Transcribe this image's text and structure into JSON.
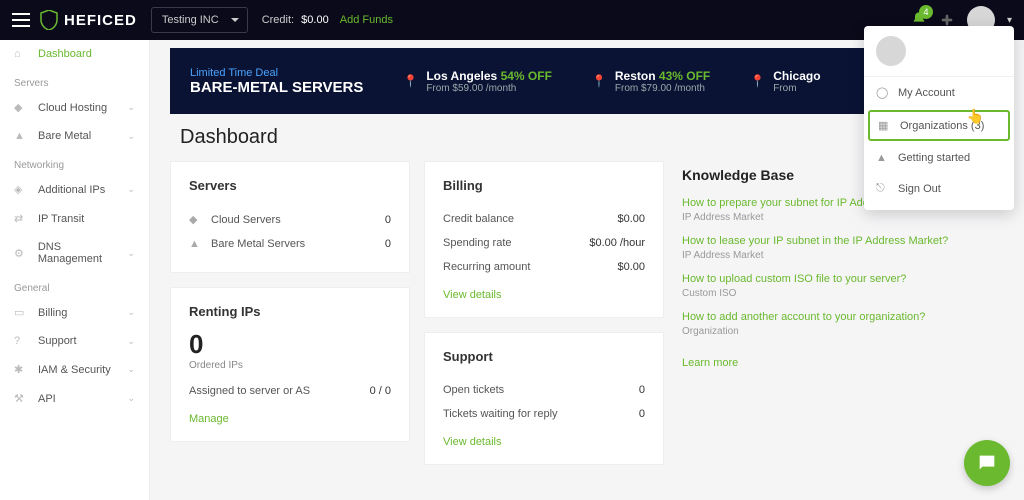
{
  "brand": "HEFICED",
  "org_selector": "Testing INC",
  "credit_label": "Credit:",
  "credit_value": "$0.00",
  "add_funds": "Add Funds",
  "notif_count": "4",
  "sidebar": {
    "dashboard": "Dashboard",
    "groups": {
      "servers": "Servers",
      "networking": "Networking",
      "general": "General"
    },
    "items": {
      "cloud_hosting": "Cloud Hosting",
      "bare_metal": "Bare Metal",
      "additional_ips": "Additional IPs",
      "ip_transit": "IP Transit",
      "dns": "DNS Management",
      "billing": "Billing",
      "support": "Support",
      "iam": "IAM & Security",
      "api": "API"
    }
  },
  "promo": {
    "tag": "Limited Time Deal",
    "title": "BARE-METAL SERVERS",
    "deals": [
      {
        "city": "Los Angeles",
        "pct": "54% OFF",
        "from": "From $59.00 /month"
      },
      {
        "city": "Reston",
        "pct": "43% OFF",
        "from": "From $79.00 /month"
      },
      {
        "city": "Chicago",
        "pct": "",
        "from": "From"
      }
    ]
  },
  "page_title": "Dashboard",
  "servers_card": {
    "title": "Servers",
    "cloud": {
      "label": "Cloud Servers",
      "count": "0"
    },
    "bare": {
      "label": "Bare Metal Servers",
      "count": "0"
    }
  },
  "renting_card": {
    "title": "Renting IPs",
    "count": "0",
    "ordered": "Ordered IPs",
    "assigned_label": "Assigned to server or AS",
    "assigned_val": "0 / 0",
    "manage": "Manage"
  },
  "billing_card": {
    "title": "Billing",
    "rows": [
      {
        "label": "Credit balance",
        "val": "$0.00"
      },
      {
        "label": "Spending rate",
        "val": "$0.00 /hour"
      },
      {
        "label": "Recurring amount",
        "val": "$0.00"
      }
    ],
    "link": "View details"
  },
  "support_card": {
    "title": "Support",
    "rows": [
      {
        "label": "Open tickets",
        "val": "0"
      },
      {
        "label": "Tickets waiting for reply",
        "val": "0"
      }
    ],
    "link": "View details"
  },
  "kb": {
    "title": "Knowledge Base",
    "items": [
      {
        "q": "How to prepare your subnet for IP Address Market?",
        "cat": "IP Address Market"
      },
      {
        "q": "How to lease your IP subnet in the IP Address Market?",
        "cat": "IP Address Market"
      },
      {
        "q": "How to upload custom ISO file to your server?",
        "cat": "Custom ISO"
      },
      {
        "q": "How to add another account to your organization?",
        "cat": "Organization"
      }
    ],
    "more": "Learn more"
  },
  "dropdown": {
    "my_account": "My Account",
    "orgs": "Organizations (3)",
    "getting_started": "Getting started",
    "sign_out": "Sign Out"
  }
}
